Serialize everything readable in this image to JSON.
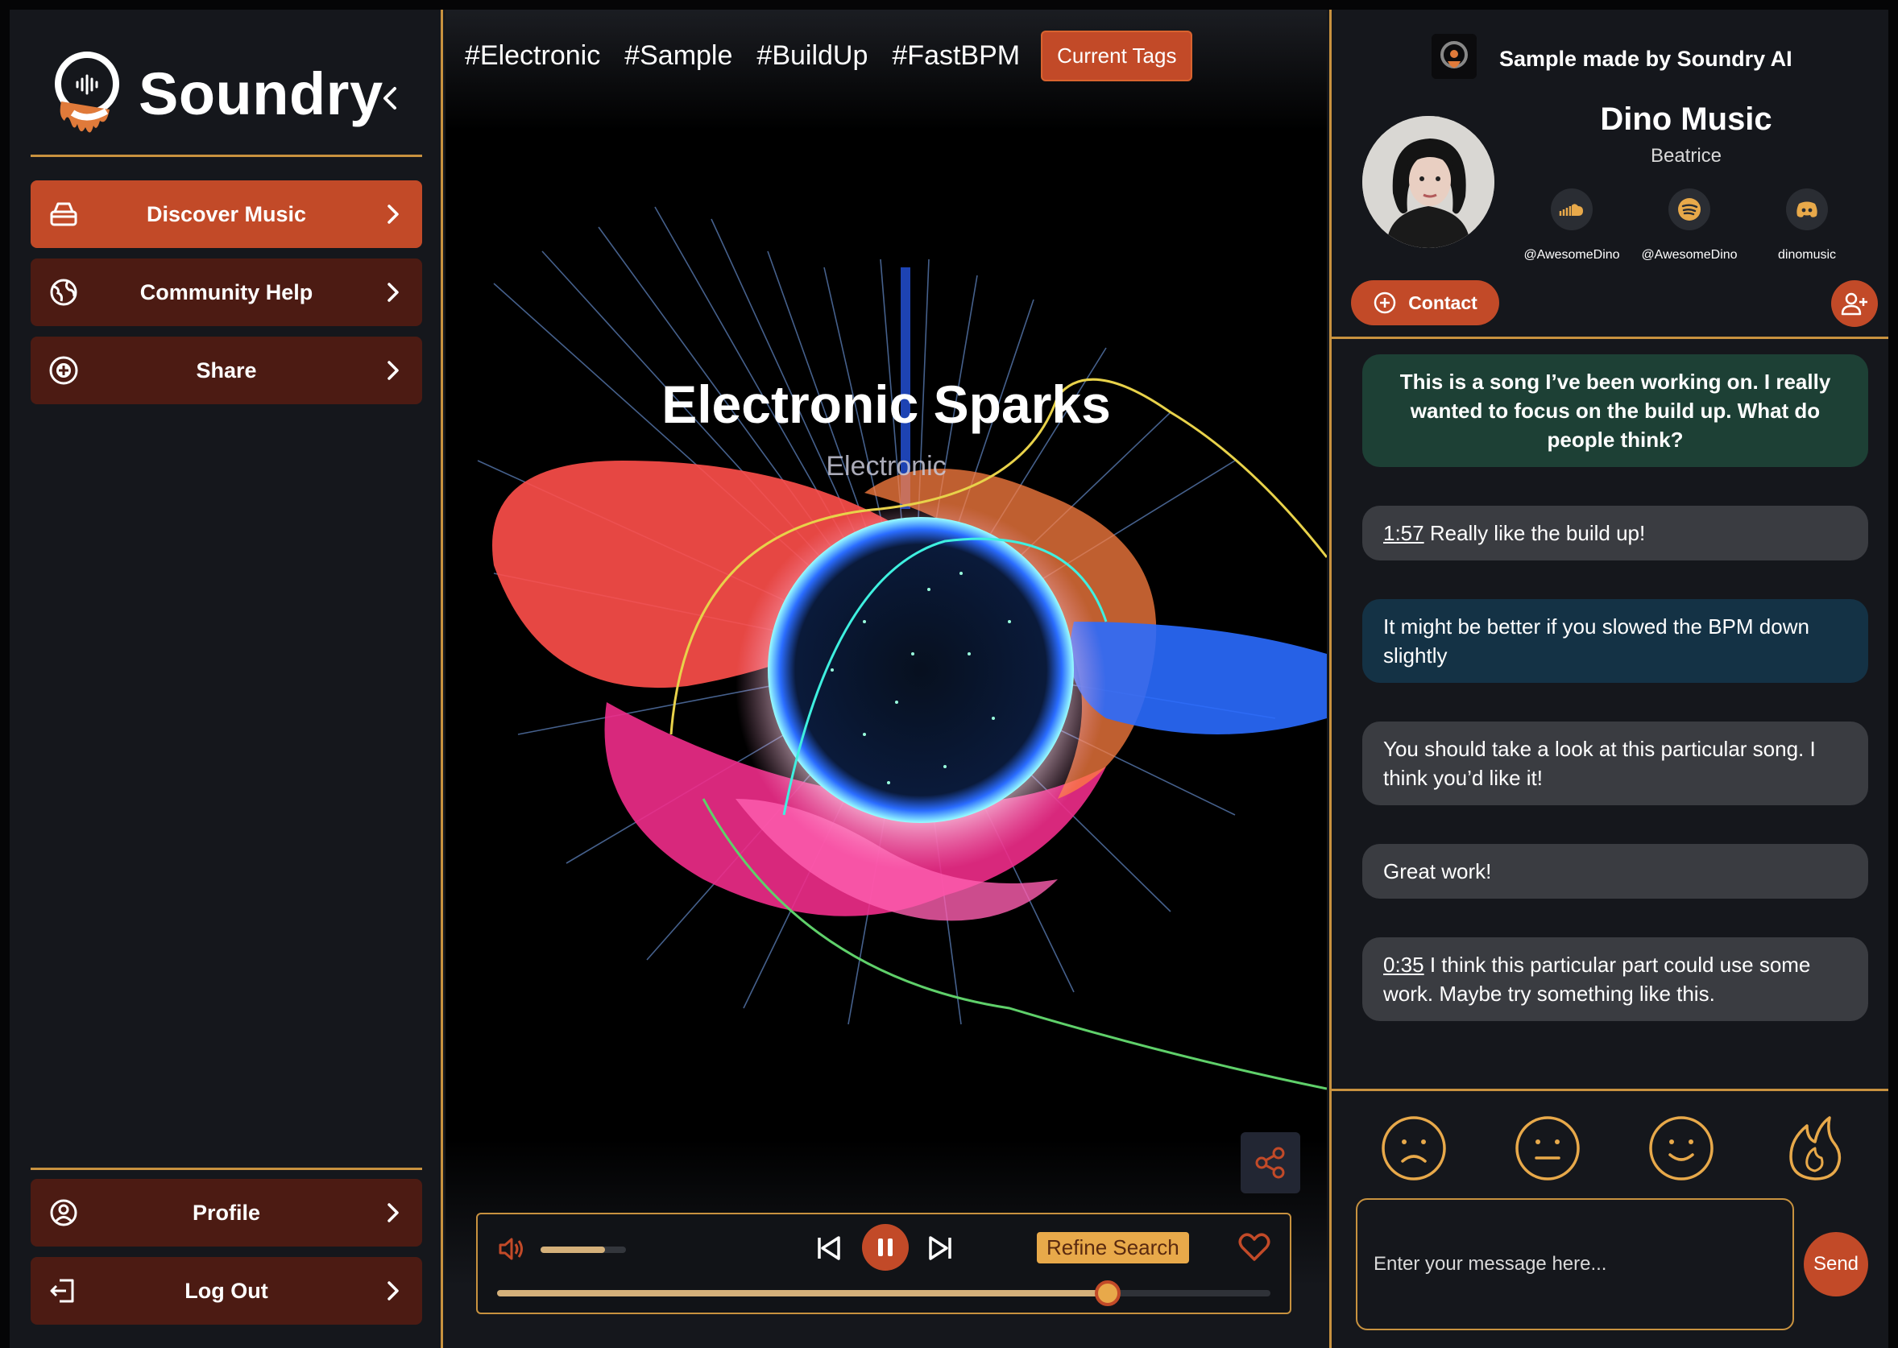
{
  "app": {
    "brand": "Soundry"
  },
  "sidebar": {
    "items": [
      {
        "label": "Discover Music",
        "icon": "box-icon",
        "active": true
      },
      {
        "label": "Community Help",
        "icon": "globe-icon",
        "active": false
      },
      {
        "label": "Share",
        "icon": "plus-circle-icon",
        "active": false
      }
    ],
    "bottom_items": [
      {
        "label": "Profile",
        "icon": "user-circle-icon"
      },
      {
        "label": "Log Out",
        "icon": "logout-icon"
      }
    ]
  },
  "main": {
    "tags": [
      "#Electronic",
      "#Sample",
      "#BuildUp",
      "#FastBPM"
    ],
    "current_tags_label": "Current Tags",
    "song_title": "Electronic Sparks",
    "song_genre": "Electronic"
  },
  "player": {
    "volume_level": 0.75,
    "progress": 0.79,
    "refine_label": "Refine Search"
  },
  "right": {
    "ai_label": "Sample made by Soundry AI",
    "artist_name": "Dino Music",
    "artist_subtitle": "Beatrice",
    "socials": [
      {
        "icon": "soundcloud-icon",
        "handle": "@AwesomeDino"
      },
      {
        "icon": "spotify-icon",
        "handle": "@AwesomeDino"
      },
      {
        "icon": "discord-icon",
        "handle": "dinomusic"
      }
    ],
    "contact_label": "Contact",
    "messages": [
      {
        "timestamp": "",
        "text": "This is a song I’ve been working on. I really wanted to focus on the build up. What do people think?",
        "style": "green"
      },
      {
        "timestamp": "1:57",
        "text": " Really like the build up!",
        "style": "grey"
      },
      {
        "timestamp": "",
        "text": "It might be better if you slowed the BPM down slightly",
        "style": "blue"
      },
      {
        "timestamp": "",
        "text": "You should take a look at this particular song. I think you’d like it!",
        "style": "grey"
      },
      {
        "timestamp": "",
        "text": "Great work!",
        "style": "grey"
      },
      {
        "timestamp": "0:35",
        "text": " I think this particular part could use some work. Maybe try something like this.",
        "style": "grey"
      }
    ],
    "reactions": [
      "sad-face-icon",
      "neutral-face-icon",
      "smile-face-icon",
      "fire-icon"
    ],
    "input_placeholder": "Enter your message here...",
    "send_label": "Send"
  },
  "colors": {
    "accent": "#c24a28",
    "accent_dark": "#4c1b13",
    "gold": "#c8923f",
    "panel": "#15171c"
  }
}
